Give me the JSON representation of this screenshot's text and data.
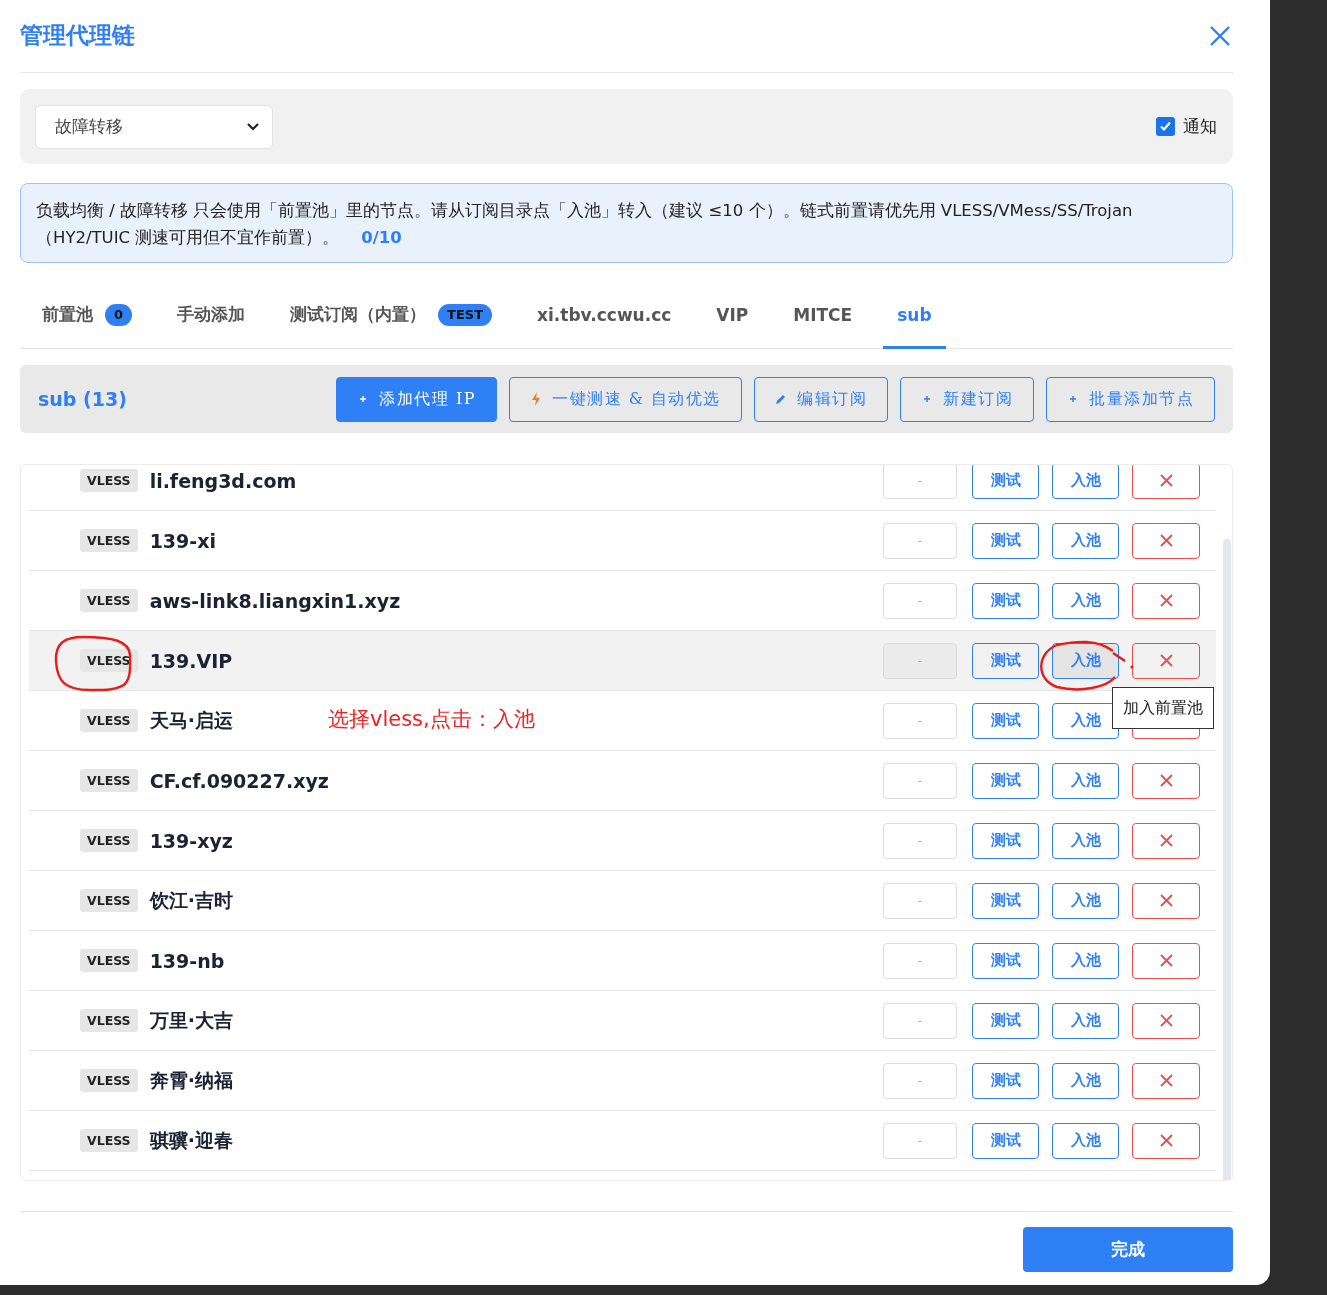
{
  "dialog": {
    "title": "管理代理链"
  },
  "mode_select": {
    "value": "故障转移"
  },
  "notify": {
    "label": "通知",
    "checked": true
  },
  "info": {
    "text": "负载均衡 / 故障转移 只会使用「前置池」里的节点。请从订阅目录点「入池」转入（建议 ≤10 个）。链式前置请优先用 VLESS/VMess/SS/Trojan（HY2/TUIC 测速可用但不宜作前置）。",
    "count": "0/10"
  },
  "tabs": [
    {
      "label": "前置池",
      "badge": "0",
      "selected": false
    },
    {
      "label": "手动添加",
      "selected": false
    },
    {
      "label": "测试订阅（内置）",
      "badge": "TEST",
      "selected": false
    },
    {
      "label": "xi.tbv.ccwu.cc",
      "selected": false
    },
    {
      "label": "VIP",
      "selected": false
    },
    {
      "label": "MITCE",
      "selected": false
    },
    {
      "label": "sub",
      "selected": true
    }
  ],
  "toolbar": {
    "title": "sub (13)",
    "buttons": [
      {
        "kind": "primary",
        "label": "添加代理 IP"
      },
      {
        "kind": "outline",
        "label": "一键测速 & 自动优选"
      },
      {
        "kind": "outline",
        "label": "编辑订阅"
      },
      {
        "kind": "outline",
        "label": "新建订阅"
      },
      {
        "kind": "outline",
        "label": "批量添加节点"
      }
    ]
  },
  "nodes": [
    {
      "type": "VLESS",
      "name": "li.feng3d.com",
      "latency": "-",
      "test": "测试",
      "pool": "入池",
      "hovered": false
    },
    {
      "type": "VLESS",
      "name": "139-xi",
      "latency": "-",
      "test": "测试",
      "pool": "入池",
      "hovered": false
    },
    {
      "type": "VLESS",
      "name": "aws-link8.liangxin1.xyz",
      "latency": "-",
      "test": "测试",
      "pool": "入池",
      "hovered": false
    },
    {
      "type": "VLESS",
      "name": "139.VIP",
      "latency": "-",
      "test": "测试",
      "pool": "入池",
      "hovered": true,
      "marked": true,
      "tooltip": "加入前置池"
    },
    {
      "type": "VLESS",
      "name": "天马·启运",
      "latency": "-",
      "test": "测试",
      "pool": "入池",
      "hovered": false,
      "note": "选择vless,点击：入池"
    },
    {
      "type": "VLESS",
      "name": "CF.cf.090227.xyz",
      "latency": "-",
      "test": "测试",
      "pool": "入池",
      "hovered": false
    },
    {
      "type": "VLESS",
      "name": "139-xyz",
      "latency": "-",
      "test": "测试",
      "pool": "入池",
      "hovered": false
    },
    {
      "type": "VLESS",
      "name": "饮江·吉时",
      "latency": "-",
      "test": "测试",
      "pool": "入池",
      "hovered": false
    },
    {
      "type": "VLESS",
      "name": "139-nb",
      "latency": "-",
      "test": "测试",
      "pool": "入池",
      "hovered": false
    },
    {
      "type": "VLESS",
      "name": "万里·大吉",
      "latency": "-",
      "test": "测试",
      "pool": "入池",
      "hovered": false
    },
    {
      "type": "VLESS",
      "name": "奔霄·纳福",
      "latency": "-",
      "test": "测试",
      "pool": "入池",
      "hovered": false
    },
    {
      "type": "VLESS",
      "name": "骐骥·迎春",
      "latency": "-",
      "test": "测试",
      "pool": "入池",
      "hovered": false
    }
  ],
  "footer": {
    "done": "完成"
  }
}
